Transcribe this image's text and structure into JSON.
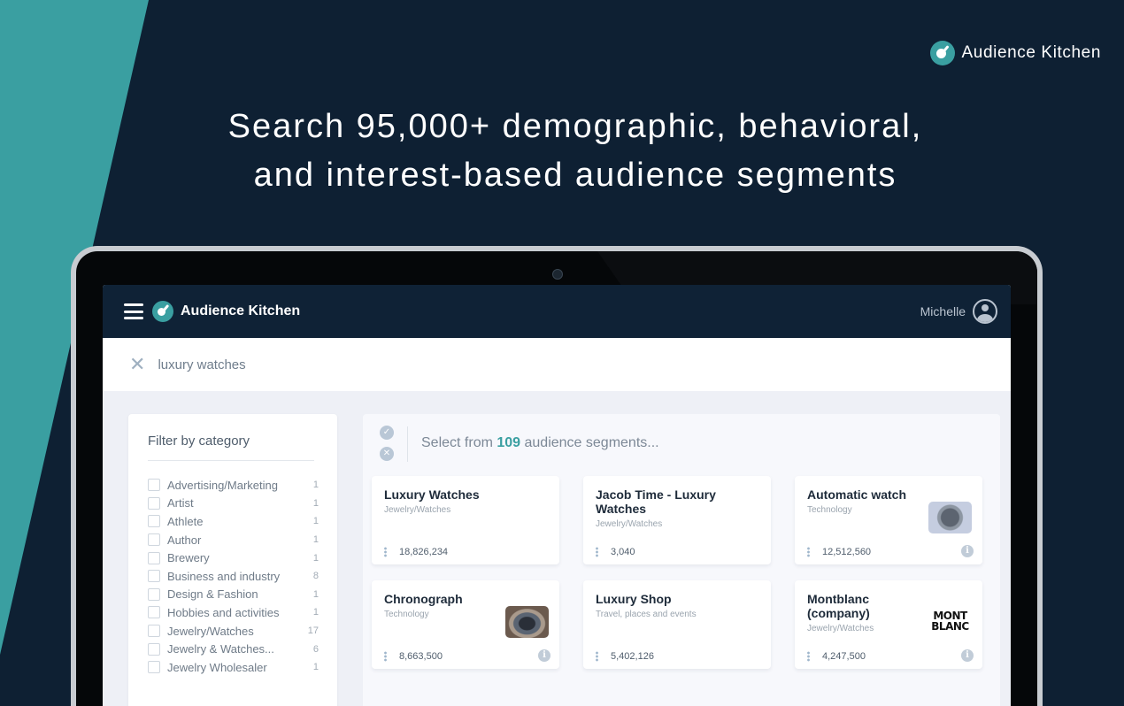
{
  "brand": {
    "name": "Audience Kitchen"
  },
  "headline": {
    "line1": "Search 95,000+ demographic, behavioral,",
    "line2": "and interest-based audience segments"
  },
  "app": {
    "title": "Audience Kitchen",
    "user": "Michelle",
    "search_value": "luxury watches",
    "filter_title": "Filter by category",
    "filters": [
      {
        "label": "Advertising/Marketing",
        "count": "1"
      },
      {
        "label": "Artist",
        "count": "1"
      },
      {
        "label": "Athlete",
        "count": "1"
      },
      {
        "label": "Author",
        "count": "1"
      },
      {
        "label": "Brewery",
        "count": "1"
      },
      {
        "label": "Business and industry",
        "count": "8"
      },
      {
        "label": "Design & Fashion",
        "count": "1"
      },
      {
        "label": "Hobbies and activities",
        "count": "1"
      },
      {
        "label": "Jewelry/Watches",
        "count": "17"
      },
      {
        "label": "Jewelry & Watches...",
        "count": "6"
      },
      {
        "label": "Jewelry Wholesaler",
        "count": "1"
      }
    ],
    "results_prefix": "Select from ",
    "results_count": "109",
    "results_suffix": " audience segments...",
    "cards": [
      {
        "title": "Luxury Watches",
        "category": "Jewelry/Watches",
        "count": "18,826,234"
      },
      {
        "title": "Jacob Time - Luxury Watches",
        "category": "Jewelry/Watches",
        "count": "3,040"
      },
      {
        "title": "Automatic watch",
        "category": "Technology",
        "count": "12,512,560"
      },
      {
        "title": "Chronograph",
        "category": "Technology",
        "count": "8,663,500"
      },
      {
        "title": "Luxury Shop",
        "category": "Travel, places and events",
        "count": "5,402,126"
      },
      {
        "title": "Montblanc (company)",
        "category": "Jewelry/Watches",
        "count": "4,247,500",
        "logo_line1": "MONT",
        "logo_line2": "BLANC"
      }
    ]
  },
  "colors": {
    "teal": "#3a9fa1",
    "navy": "#0e2033",
    "appbar": "#0f2236"
  }
}
